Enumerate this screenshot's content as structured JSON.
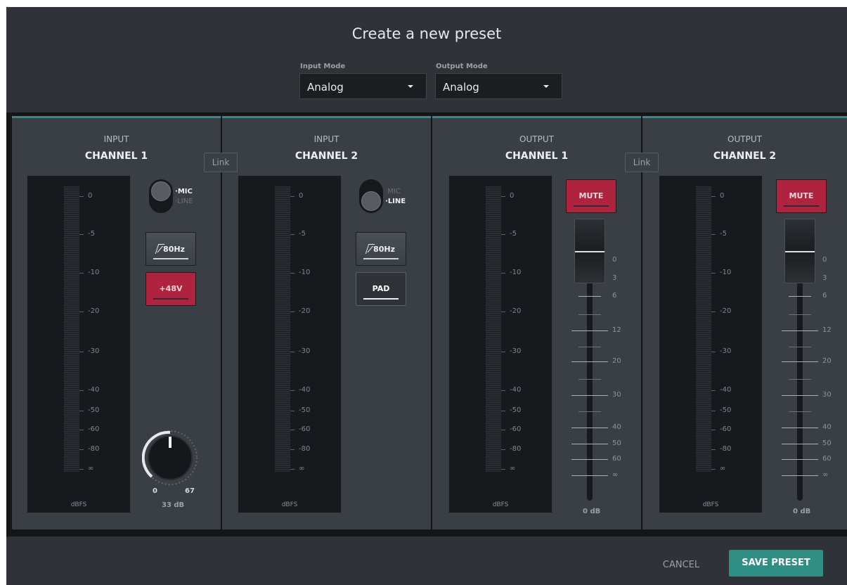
{
  "dialog": {
    "title": "Create a new preset"
  },
  "modes": {
    "input": {
      "label": "Input Mode",
      "value": "Analog"
    },
    "output": {
      "label": "Output Mode",
      "value": "Analog"
    }
  },
  "colors": {
    "accent": "#2f8f85",
    "active_red": "#b0233f",
    "panel": "#3a3f46",
    "meter_bg": "#17191c"
  },
  "meter_scale": [
    "0",
    "-5",
    "-10",
    "-20",
    "-30",
    "-40",
    "-50",
    "-60",
    "-80",
    "∞"
  ],
  "fader_scale": [
    "0",
    "3",
    "6",
    "12",
    "20",
    "30",
    "40",
    "50",
    "60",
    "∞"
  ],
  "meter_unit": "dBFS",
  "link_label": "Link",
  "strips": [
    {
      "type": "INPUT",
      "name": "CHANNEL 1",
      "switch_top": "MIC",
      "switch_bottom": "LINE",
      "switch_selected": "MIC",
      "hpf_label": "80Hz",
      "aux_button": "+48V",
      "aux_active": true,
      "gain": {
        "min": "0",
        "max": "67",
        "value": "33 dB"
      }
    },
    {
      "type": "INPUT",
      "name": "CHANNEL 2",
      "switch_top": "MIC",
      "switch_bottom": "LINE",
      "switch_selected": "LINE",
      "hpf_label": "80Hz",
      "aux_button": "PAD",
      "aux_active": false
    },
    {
      "type": "OUTPUT",
      "name": "CHANNEL 1",
      "mute_label": "MUTE",
      "mute_active": true,
      "level": "0 dB"
    },
    {
      "type": "OUTPUT",
      "name": "CHANNEL 2",
      "mute_label": "MUTE",
      "mute_active": true,
      "level": "0 dB"
    }
  ],
  "footer": {
    "cancel": "CANCEL",
    "save": "SAVE PRESET"
  }
}
